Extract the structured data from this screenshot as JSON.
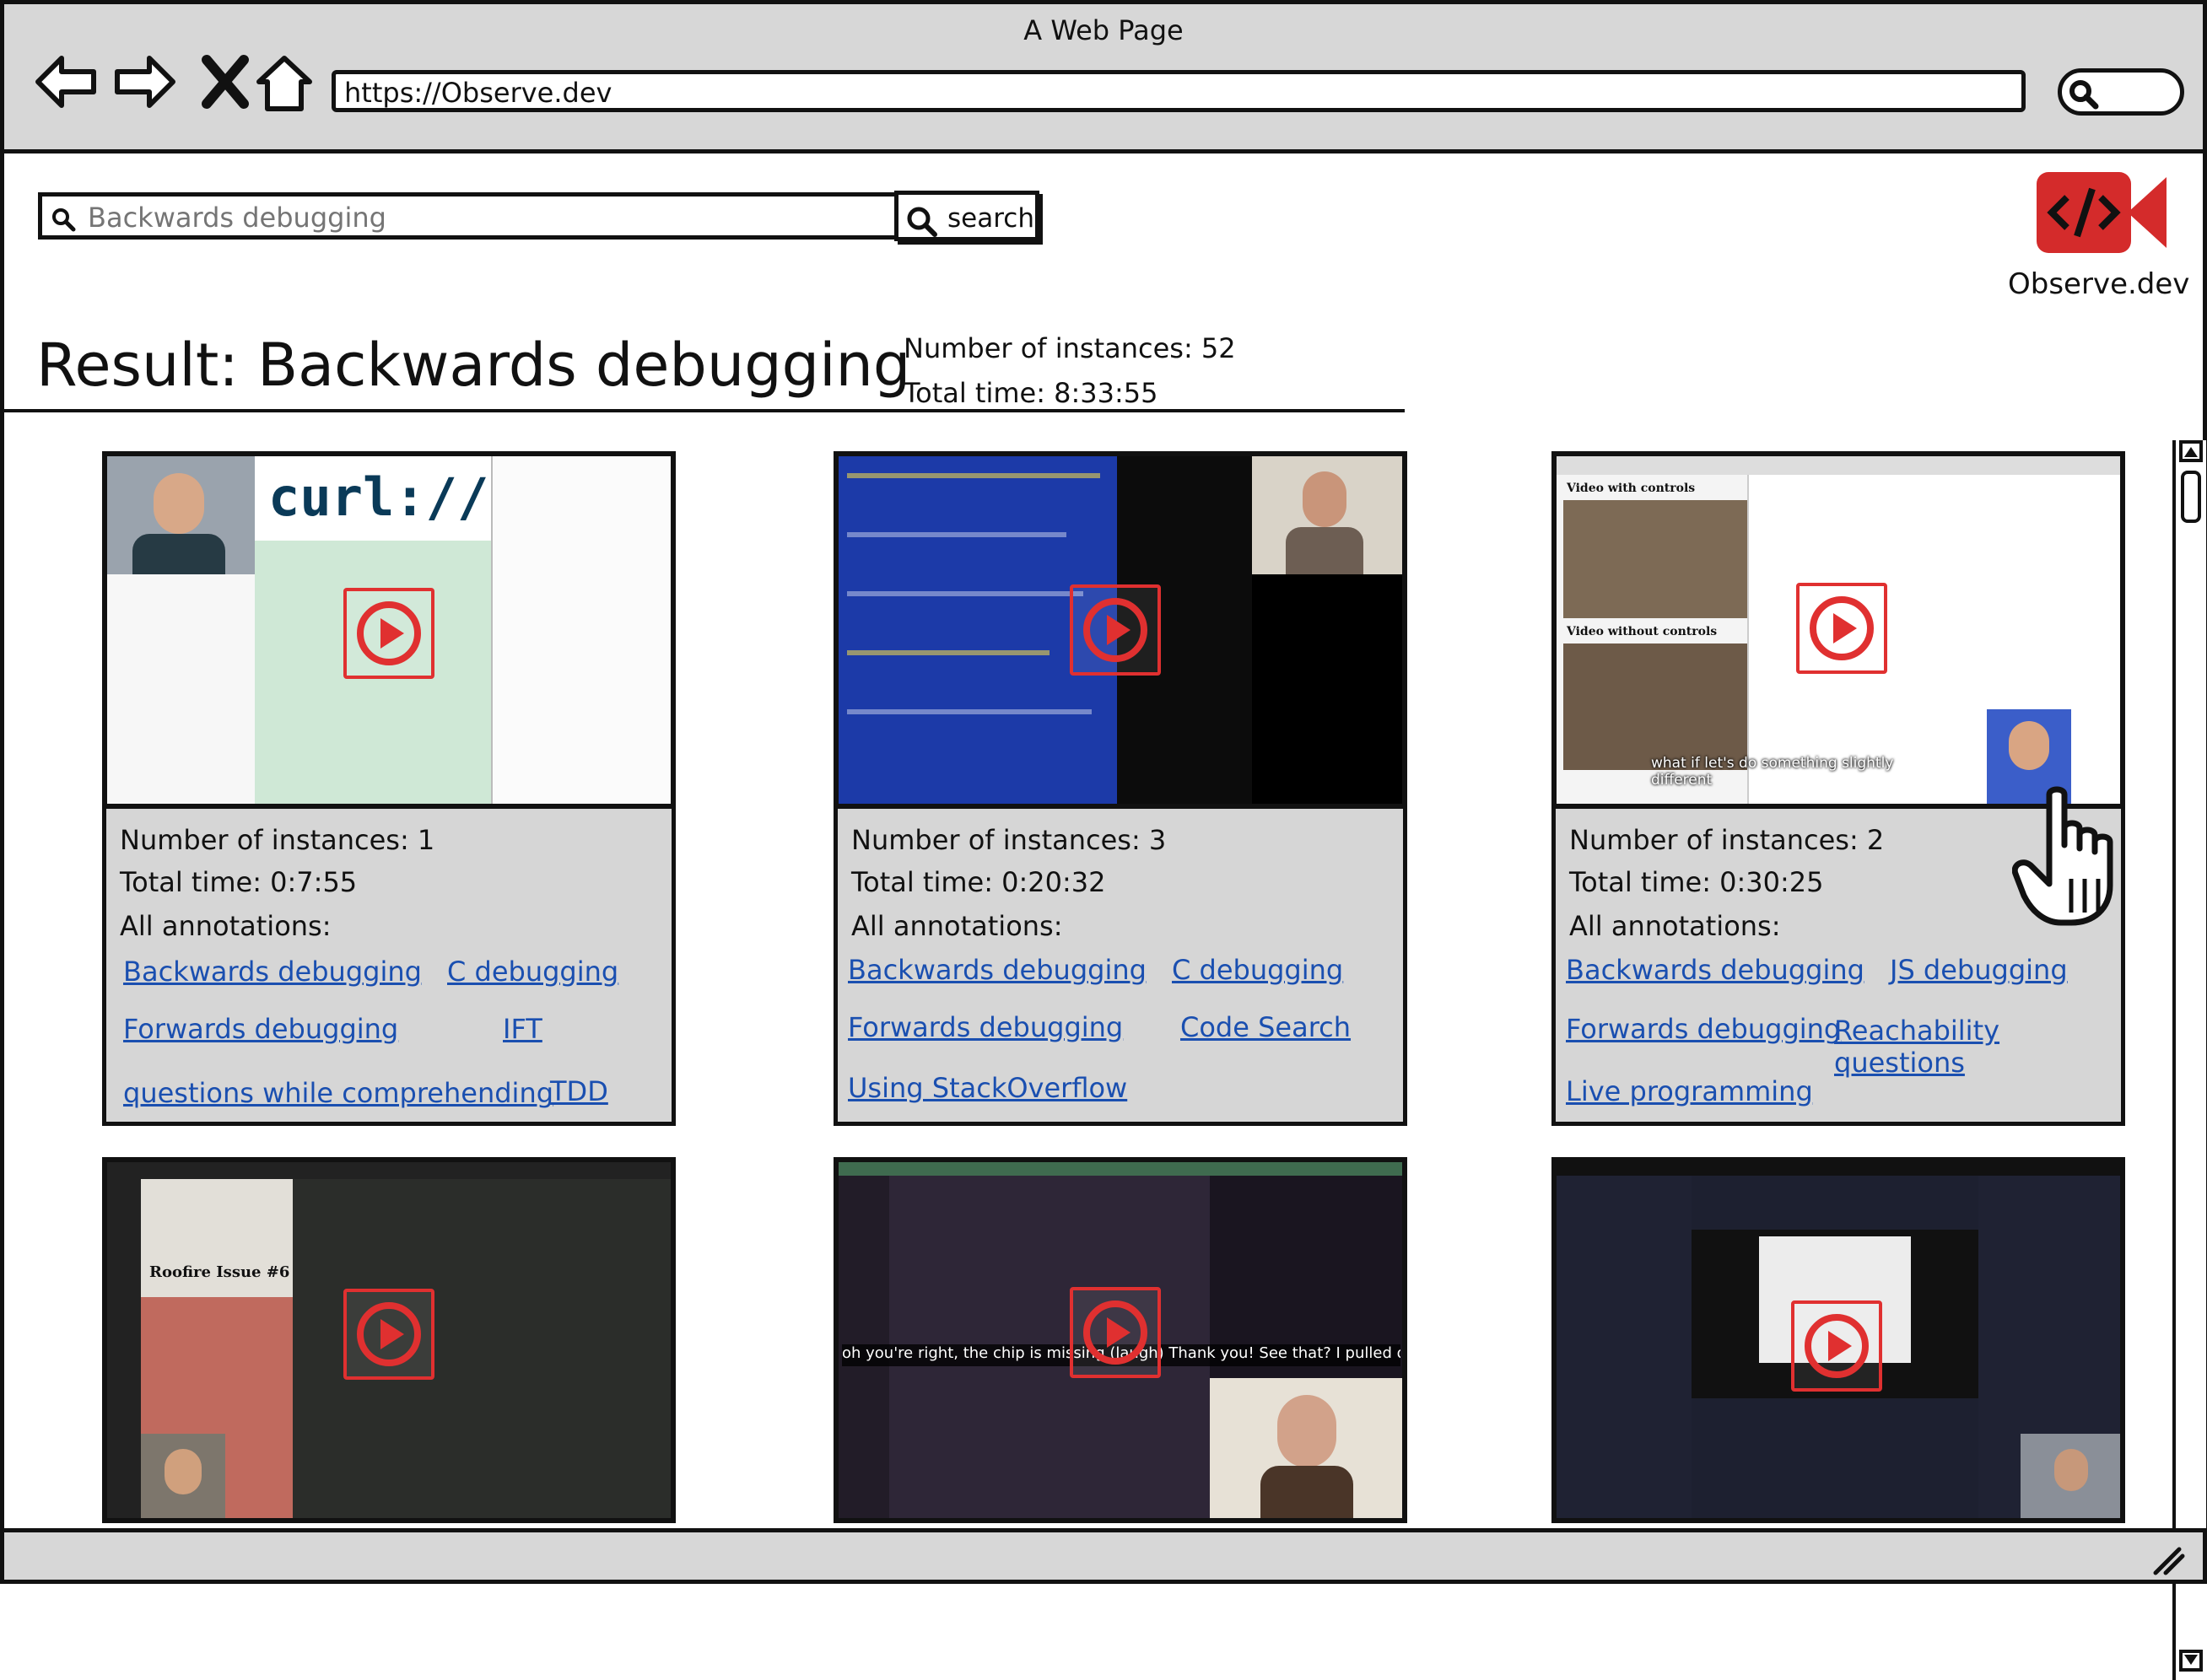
{
  "window": {
    "title": "A Web Page",
    "url": "https://Observe.dev"
  },
  "search": {
    "placeholder": "Backwards debugging",
    "button_label": "search"
  },
  "brand": {
    "name": "Observe.dev",
    "logo_color": "#d42b2b"
  },
  "result": {
    "title": "Result: Backwards debugging",
    "instances": "Number of instances: 52",
    "total_time": "Total time: 8:33:55"
  },
  "annotations_label": "All annotations:",
  "cards": [
    {
      "instances": "Number of instances: 1",
      "time": "Total time: 0:7:55",
      "tags": [
        "Backwards debugging",
        "C debugging",
        "Forwards debugging",
        "IFT",
        "questions while comprehending",
        "TDD"
      ]
    },
    {
      "instances": "Number of instances: 3",
      "time": "Total time: 0:20:32",
      "tags": [
        "Backwards debugging",
        "C debugging",
        "Forwards debugging",
        "Code Search",
        "Using StackOverflow"
      ]
    },
    {
      "instances": "Number of instances: 2",
      "time": "Total time: 0:30:25",
      "tags": [
        "Backwards debugging",
        "JS debugging",
        "Forwards debugging",
        "Reachability questions",
        "Live programming"
      ]
    }
  ],
  "thumbnails": {
    "t1_logo": "curl://",
    "t3_label1": "Video with controls",
    "t3_label2": "Video without controls",
    "t3_caption": "what if let's do something slightly different",
    "t4_title": "Roofire Issue #6",
    "t5_caption": "oh you're right, the chip is missing (laugh) Thank you! See that? I pulled out the Ardui"
  },
  "colors": {
    "play_border": "#e03030",
    "link": "#1a4fb0",
    "panel_bg": "#d6d6d6"
  }
}
